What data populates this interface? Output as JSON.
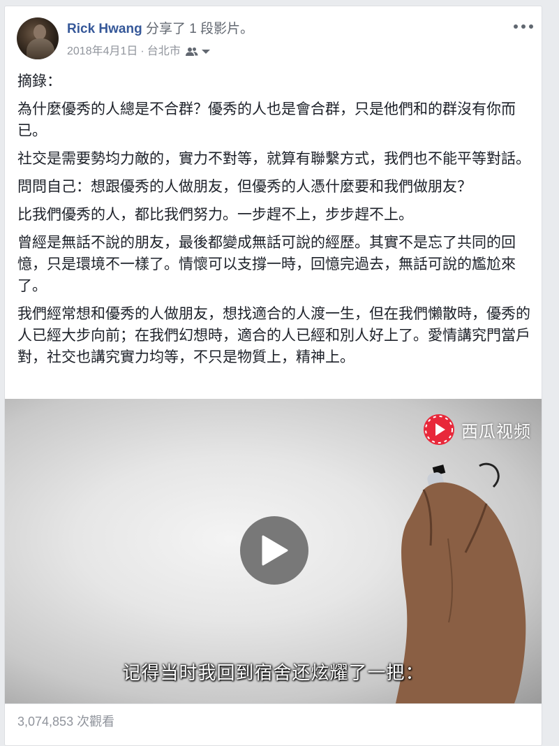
{
  "post": {
    "author": "Rick Hwang",
    "action": "分享了 1 段影片。",
    "date": "2018年4月1日",
    "separator": "·",
    "location": "台北市",
    "audience_icon": "friends-icon",
    "paragraphs": [
      "摘錄：",
      "為什麼優秀的人總是不合群？優秀的人也是會合群，只是他們和的群沒有你而已。",
      "社交是需要勢均力敵的，實力不對等，就算有聯繫方式，我們也不能平等對話。",
      "問問自己：想跟優秀的人做朋友，但優秀的人憑什麼要和我們做朋友？",
      "比我們優秀的人，都比我們努力。一步趕不上，步步趕不上。",
      "曾經是無話不說的朋友，最後都變成無話可說的經歷。其實不是忘了共同的回憶，只是環境不一樣了。情懷可以支撐一時，回憶完過去，無話可說的尷尬來了。",
      "我們經常想和優秀的人做朋友，想找適合的人渡一生，但在我們懶散時，優秀的人已經大步向前；在我們幻想時，適合的人已經和別人好上了。愛情講究門當戶對，社交也講究實力均等，不只是物質上，精神上。"
    ]
  },
  "video": {
    "watermark_text": "西瓜视频",
    "subtitle": "记得当时我回到宿舍还炫耀了一把：",
    "views": "3,074,853 次觀看"
  },
  "colors": {
    "author_link": "#365899",
    "meta_gray": "#90949c",
    "xigua_red": "#e8283a"
  }
}
